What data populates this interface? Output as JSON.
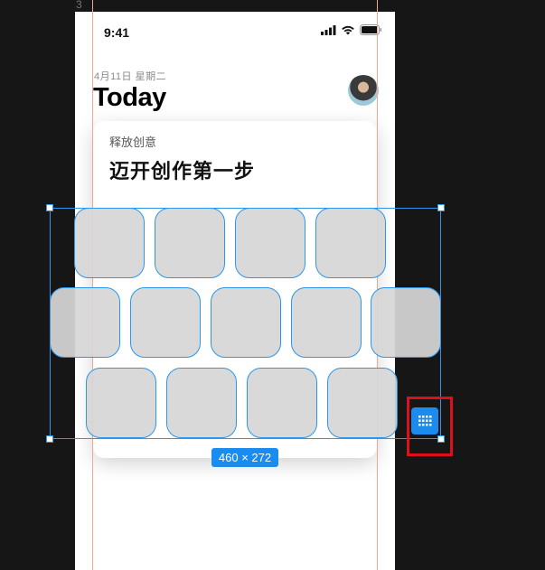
{
  "canvas": {
    "artboard_label": "3"
  },
  "status_bar": {
    "time": "9:41",
    "icons": [
      "cellular-signal-icon",
      "wifi-icon",
      "battery-icon"
    ]
  },
  "header": {
    "date": "4月11日 星期二",
    "title": "Today"
  },
  "card": {
    "subtitle": "释放创意",
    "title": "迈开创作第一步"
  },
  "tile_grid": {
    "rows": [
      4,
      5,
      4
    ]
  },
  "selection": {
    "size_label": "460 × 272"
  },
  "tool_button": {
    "icon": "grid-dots-icon"
  },
  "colors": {
    "selection_blue": "#1a8cf0",
    "guide": "#f0a890",
    "highlight": "#e0101a"
  }
}
